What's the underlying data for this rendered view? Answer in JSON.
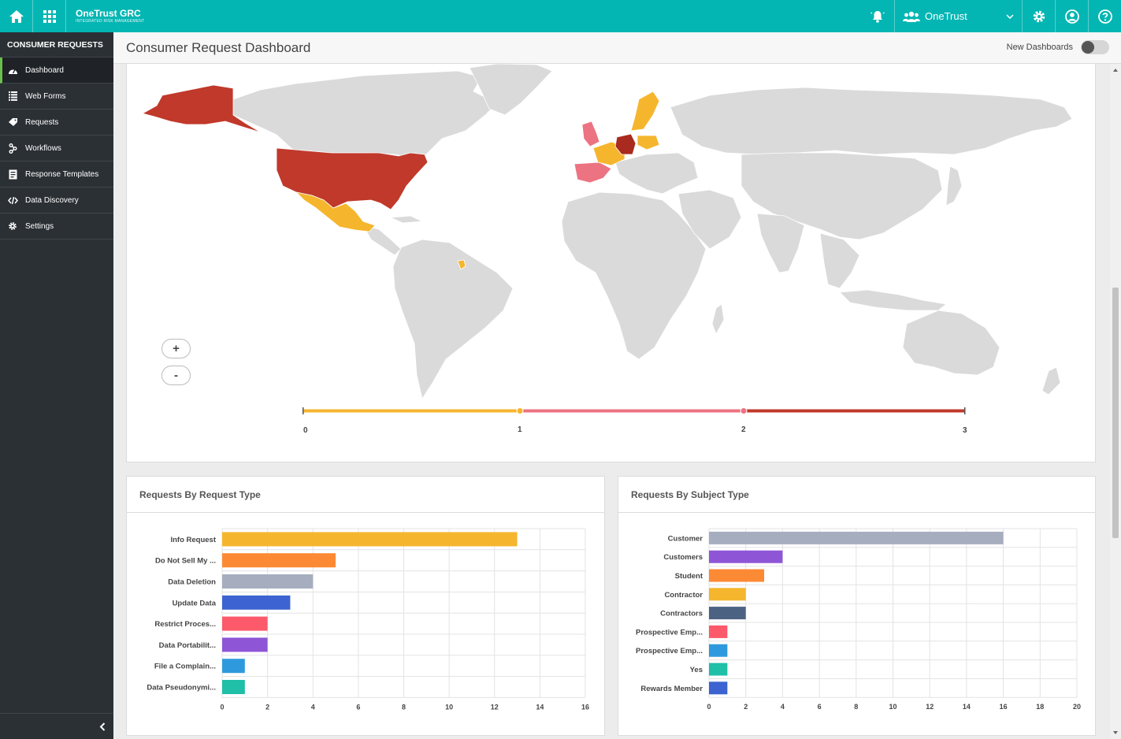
{
  "topbar": {
    "brand_name": "OneTrust GRC",
    "brand_tagline": "INTEGRATED RISK MANAGEMENT",
    "org_name": "OneTrust",
    "color": "#03b6b3"
  },
  "sidebar": {
    "title": "CONSUMER REQUESTS",
    "items": [
      {
        "label": "Dashboard",
        "icon": "gauge-icon",
        "active": true
      },
      {
        "label": "Web Forms",
        "icon": "list-icon"
      },
      {
        "label": "Requests",
        "icon": "tag-icon"
      },
      {
        "label": "Workflows",
        "icon": "workflow-icon"
      },
      {
        "label": "Response Templates",
        "icon": "template-icon"
      },
      {
        "label": "Data Discovery",
        "icon": "code-icon"
      },
      {
        "label": "Settings",
        "icon": "gear-icon"
      }
    ]
  },
  "header": {
    "title": "Consumer Request Dashboard",
    "new_dashboards_label": "New Dashboards",
    "new_dashboards_enabled": false
  },
  "map": {
    "zoom_in": "+",
    "zoom_out": "-",
    "legend_ticks": [
      "0",
      "1",
      "2",
      "3"
    ],
    "legend_colors": [
      "#f5b62e",
      "#ec7382",
      "#c0392b"
    ],
    "countries_with_value_3": [
      "United States",
      "Alaska",
      "Germany"
    ],
    "countries_with_value_2": [
      "United Kingdom",
      "Spain"
    ],
    "countries_with_value_1": [
      "Mexico",
      "France",
      "Sweden",
      "Poland",
      "French Guiana"
    ]
  },
  "charts": {
    "request_type": {
      "title": "Requests By Request Type"
    },
    "subject_type": {
      "title": "Requests By Subject Type"
    }
  },
  "chart_data": [
    {
      "type": "bar",
      "orientation": "horizontal",
      "title": "Requests By Request Type",
      "categories": [
        "Info Request",
        "Do Not Sell My ...",
        "Data Deletion",
        "Update Data",
        "Restrict Proces...",
        "Data Portabilit...",
        "File a Complain...",
        "Data Pseudonymi..."
      ],
      "values": [
        13,
        5,
        4,
        3,
        2,
        2,
        1,
        1
      ],
      "colors": [
        "#f5b62e",
        "#fc8a35",
        "#a5adbf",
        "#3c63d1",
        "#fc5a6a",
        "#8e56d6",
        "#2f99dd",
        "#1fbfa8"
      ],
      "xlim": [
        0,
        16
      ],
      "xticks": [
        0,
        2,
        4,
        6,
        8,
        10,
        12,
        14,
        16
      ],
      "grid": true
    },
    {
      "type": "bar",
      "orientation": "horizontal",
      "title": "Requests By Subject Type",
      "categories": [
        "Customer",
        "Customers",
        "Student",
        "Contractor",
        "Contractors",
        "Prospective Emp...",
        "Prospective Emp...",
        "Yes",
        "Rewards Member"
      ],
      "values": [
        16,
        4,
        3,
        2,
        2,
        1,
        1,
        1,
        1
      ],
      "colors": [
        "#a5adbf",
        "#8e56d6",
        "#fc8a35",
        "#f5b62e",
        "#4b6283",
        "#fc5a6a",
        "#2f99dd",
        "#1fbfa8",
        "#3c63d1"
      ],
      "xlim": [
        0,
        20
      ],
      "xticks": [
        0,
        2,
        4,
        6,
        8,
        10,
        12,
        14,
        16,
        18,
        20
      ],
      "grid": true
    }
  ]
}
